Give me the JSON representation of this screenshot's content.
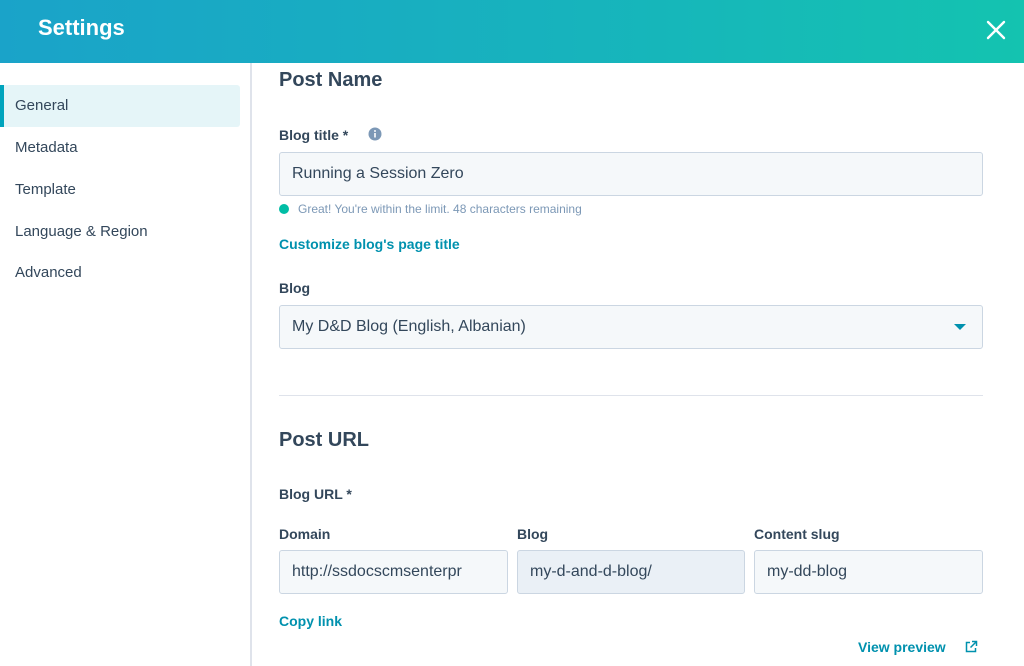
{
  "header": {
    "title": "Settings"
  },
  "sidebar": {
    "items": [
      {
        "label": "General"
      },
      {
        "label": "Metadata"
      },
      {
        "label": "Template"
      },
      {
        "label": "Language & Region"
      },
      {
        "label": "Advanced"
      }
    ]
  },
  "post_name": {
    "section_title": "Post Name",
    "blog_title_label": "Blog title *",
    "blog_title_value": "Running a Session Zero",
    "hint": "Great! You're within the limit. 48 characters remaining",
    "customize_link": "Customize blog's page title",
    "blog_label": "Blog",
    "blog_selected": "My D&D Blog (English, Albanian)"
  },
  "post_url": {
    "section_title": "Post URL",
    "blog_url_label": "Blog URL *",
    "domain_label": "Domain",
    "domain_value": "http://ssdocscmsenterpr",
    "blog_label": "Blog",
    "blog_value": "my-d-and-d-blog/",
    "slug_label": "Content slug",
    "slug_value": "my-dd-blog",
    "copy_link": "Copy link",
    "view_preview": "View preview"
  },
  "colors": {
    "accent": "#00a4bd",
    "link": "#0091ae",
    "success": "#00bda5",
    "header_start": "#1aa3c9",
    "header_end": "#14c3b0"
  }
}
